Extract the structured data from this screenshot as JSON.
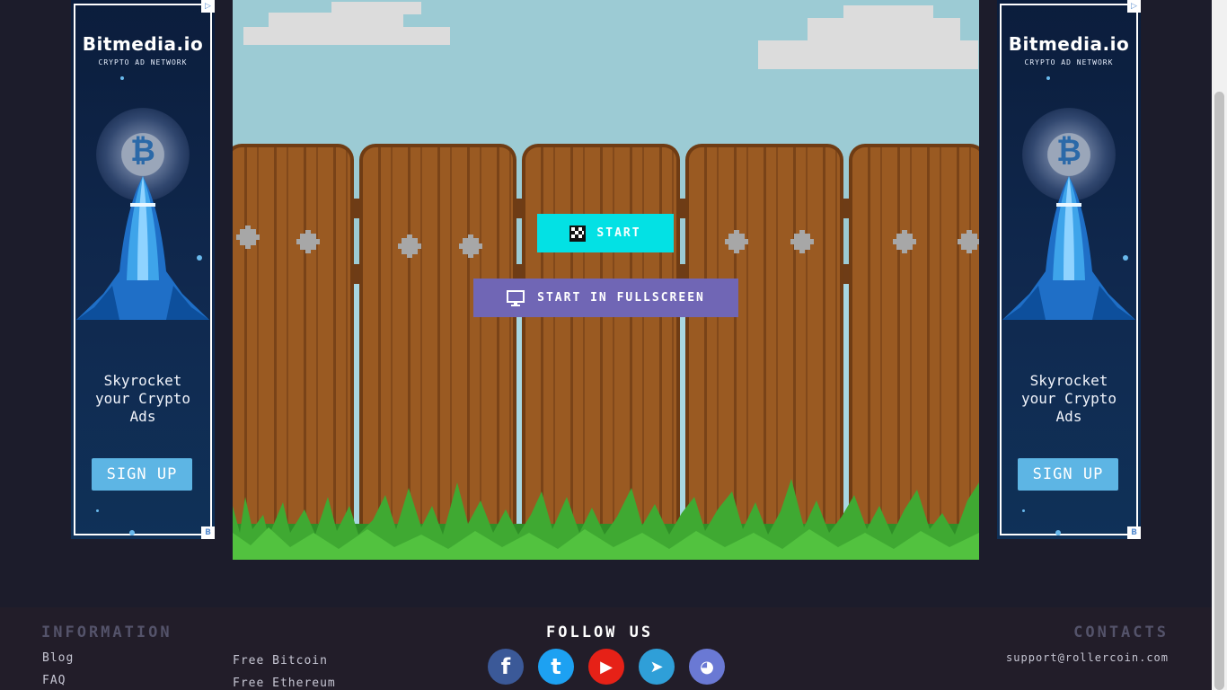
{
  "ads": {
    "left": {
      "brand": "Bitmedia.io",
      "brand_sub": "CRYPTO AD NETWORK",
      "coin_symbol": "₿",
      "tagline_1": "Skyrocket",
      "tagline_2": "your Crypto",
      "tagline_3": "Ads",
      "cta": "SIGN UP",
      "adchoices_icon": "▷",
      "badge_icon": "B"
    },
    "right": {
      "brand": "Bitmedia.io",
      "brand_sub": "CRYPTO AD NETWORK",
      "coin_symbol": "₿",
      "tagline_1": "Skyrocket",
      "tagline_2": "your Crypto",
      "tagline_3": "Ads",
      "cta": "SIGN UP",
      "adchoices_icon": "▷",
      "badge_icon": "B"
    }
  },
  "game": {
    "start_label": "START",
    "fullscreen_label": "START IN FULLSCREEN",
    "start_icon": "checkered-flag-icon",
    "fullscreen_icon": "monitor-icon",
    "colors": {
      "start": "#03e1e4",
      "fullscreen": "#7066b5",
      "sky": "#9ccbd4",
      "wood": "#9a5a22",
      "grass": "#3ba02c"
    }
  },
  "footer": {
    "info_title": "Information",
    "links_col1": [
      "Blog",
      "FAQ"
    ],
    "links_col2": [
      "Free Bitcoin",
      "Free Ethereum"
    ],
    "follow_title": "Follow us",
    "social": [
      {
        "name": "facebook",
        "glyph": "f",
        "color": "#3b5998"
      },
      {
        "name": "twitter",
        "glyph": "t",
        "color": "#1da1f2"
      },
      {
        "name": "youtube",
        "glyph": "▶",
        "color": "#e62117"
      },
      {
        "name": "telegram",
        "glyph": "➤",
        "color": "#2f9fd8"
      },
      {
        "name": "discord",
        "glyph": "◕",
        "color": "#6a79d4"
      }
    ],
    "contacts_title": "Contacts",
    "email": "support@rollercoin.com"
  }
}
